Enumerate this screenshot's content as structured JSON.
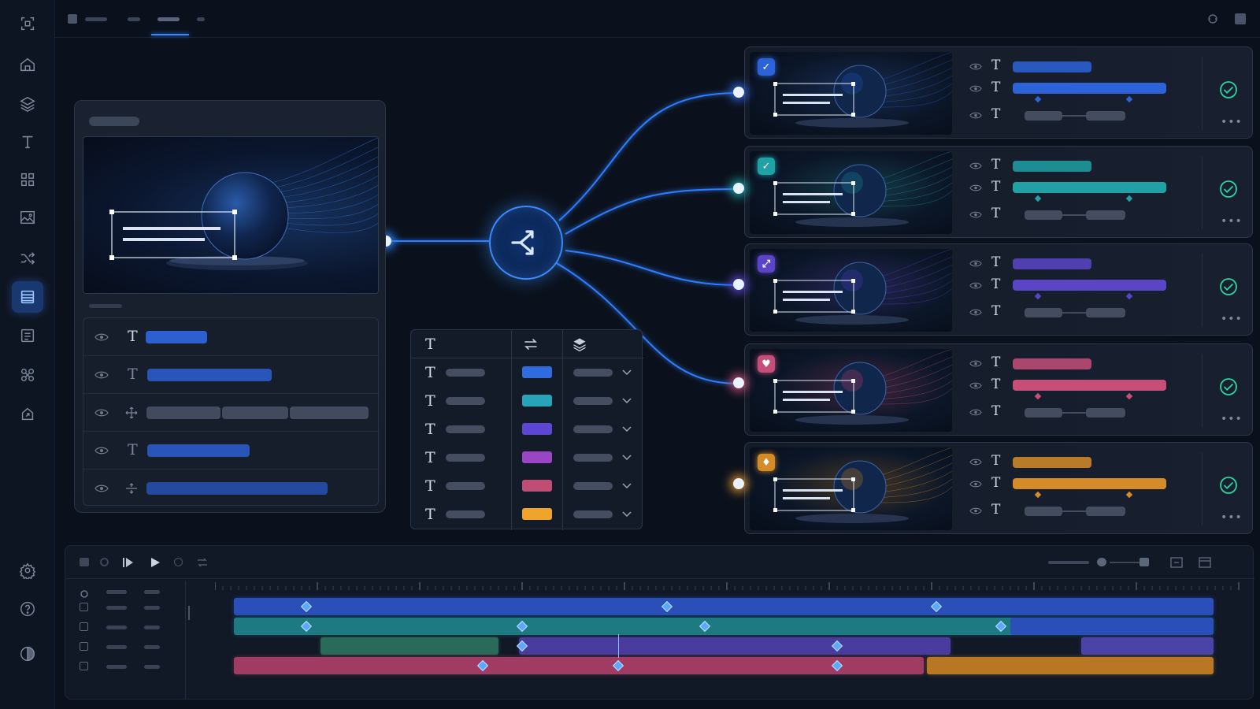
{
  "colors": {
    "accent": "#3a85ff",
    "blue": "#2f5cc8",
    "teal": "#1f9c9a",
    "indigo": "#5444bf",
    "purple": "#8a3fb8",
    "rose": "#b84a6c",
    "amber": "#d68e2a",
    "success": "#2fd3a0"
  },
  "rail_icons": [
    "frame-icon",
    "home-icon",
    "layers-icon",
    "text-icon",
    "grid-icon",
    "image-icon",
    "shuffle-icon",
    "list-icon",
    "template-icon",
    "pinwheel-icon",
    "export-icon",
    "settings-icon",
    "help-icon",
    "theme-icon"
  ],
  "rail_active": "list-icon",
  "source": {
    "rows": [
      {
        "icon": "text-icon",
        "kind": "T"
      },
      {
        "icon": "text-icon",
        "kind": "T"
      },
      {
        "icon": "move-icon",
        "kind": "move"
      },
      {
        "icon": "text-icon",
        "kind": "T"
      },
      {
        "icon": "resize-icon",
        "kind": "resize"
      }
    ]
  },
  "mapping_table": {
    "head_text": "T",
    "rows": [
      {
        "label": "T",
        "color": "#2f6ce0"
      },
      {
        "label": "T",
        "color": "#27a4b8"
      },
      {
        "label": "T",
        "color": "#5d46d4"
      },
      {
        "label": "T",
        "color": "#9a45c4"
      },
      {
        "label": "T",
        "color": "#c04d74"
      },
      {
        "label": "T",
        "color": "#f0a52a"
      }
    ]
  },
  "variants": [
    {
      "name": "variant-blue",
      "color": "#2d63d9",
      "badge": "✓",
      "glow": "#1d4ea8",
      "prop_label": "T"
    },
    {
      "name": "variant-teal",
      "color": "#1fa1a6",
      "badge": "✓",
      "glow": "#137d8a",
      "prop_label": "T"
    },
    {
      "name": "variant-indigo",
      "color": "#5b45c7",
      "badge": "⤢",
      "glow": "#4a36b0",
      "prop_label": "T"
    },
    {
      "name": "variant-rose",
      "color": "#c64e78",
      "badge": "♥",
      "glow": "#a03868",
      "prop_label": "T"
    },
    {
      "name": "variant-amber",
      "color": "#d48c2a",
      "badge": "♦",
      "glow": "#a86e1e",
      "prop_label": "T"
    }
  ],
  "more_label": "•••"
}
